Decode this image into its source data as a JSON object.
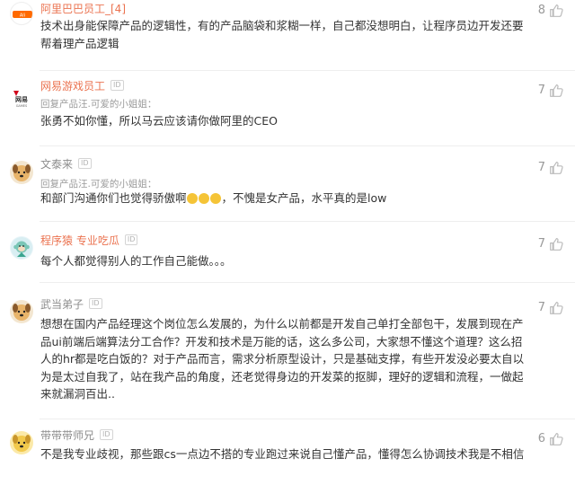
{
  "comments": [
    {
      "name": "阿里巴巴员工_[4]",
      "text": "技术出身能保障产品的逻辑性，有的产品脑袋和浆糊一样，自己都没想明白，让程序员边开发还要帮着理产品逻辑",
      "likes": "8",
      "avatar": "alibaba-logo"
    },
    {
      "name": "网易游戏员工",
      "id_badge": "ID",
      "reply_to": "回复产品汪.可爱的小姐姐：",
      "text": "张勇不如你懂，所以马云应该请你做阿里的CEO",
      "likes": "7",
      "avatar": "netease-logo"
    },
    {
      "name": "文泰来",
      "id_badge": "ID",
      "reply_to": "回复产品汪.可爱的小姐姐：",
      "text_before": "和部门沟通你们也觉得骄傲啊",
      "text_after": "，不愧是女产品，水平真的是low",
      "likes": "7",
      "avatar": "dog-avatar"
    },
    {
      "name": "程序猿 专业吃瓜",
      "id_badge": "ID",
      "text": "每个人都觉得别人的工作自己能做。。。",
      "likes": "7",
      "avatar": "monkey-avatar"
    },
    {
      "name": "武当弟子",
      "id_badge": "ID",
      "text": "想想在国内产品经理这个岗位怎么发展的，为什么以前都是开发自己单打全部包干，发展到现在产品ui前端后端算法分工合作？开发和技术是万能的话，这么多公司，大家想不懂这个道理？这么招人的hr都是吃白饭的？对于产品而言，需求分析原型设计，只是基础支撑，有些开发没必要太自以为是太过自我了，站在我产品的角度，还老觉得身边的开发菜的抠脚，理好的逻辑和流程，一做起来就漏洞百出..",
      "likes": "7",
      "avatar": "dog-avatar"
    },
    {
      "name": "带带带师兄",
      "id_badge": "ID",
      "text": "不是我专业歧视，那些跟cs一点边不搭的专业跑过来说自己懂产品，懂得怎么协调技术我是不相信",
      "likes": "6",
      "avatar": "dog-yellow-avatar"
    }
  ],
  "colors": {
    "username": "#eb7350",
    "username_grey": "#8c8c8c",
    "like_count": "#999999"
  }
}
